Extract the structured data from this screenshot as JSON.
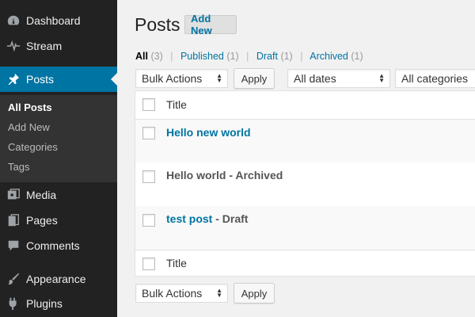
{
  "sidebar": {
    "items": [
      {
        "label": "Dashboard",
        "icon": "dashboard-icon"
      },
      {
        "label": "Stream",
        "icon": "pulse-icon"
      },
      {
        "label": "Posts",
        "icon": "pin-icon"
      },
      {
        "label": "Media",
        "icon": "media-icon"
      },
      {
        "label": "Pages",
        "icon": "pages-icon"
      },
      {
        "label": "Comments",
        "icon": "comment-icon"
      },
      {
        "label": "Appearance",
        "icon": "brush-icon"
      },
      {
        "label": "Plugins",
        "icon": "plug-icon"
      }
    ],
    "submenu": [
      "All Posts",
      "Add New",
      "Categories",
      "Tags"
    ]
  },
  "header": {
    "title": "Posts",
    "add_new": "Add New"
  },
  "filters": {
    "all": {
      "label": "All",
      "count": "(3)"
    },
    "published": {
      "label": "Published",
      "count": "(1)"
    },
    "draft": {
      "label": "Draft",
      "count": "(1)"
    },
    "archived": {
      "label": "Archived",
      "count": "(1)"
    },
    "separator": "|"
  },
  "toolbar": {
    "bulk_actions": "Bulk Actions",
    "apply": "Apply",
    "dates": "All dates",
    "categories": "All categories"
  },
  "table": {
    "column_title": "Title",
    "rows": [
      {
        "title": "Hello new world",
        "state": ""
      },
      {
        "title": "Hello world - Archived",
        "state": ""
      },
      {
        "title": "test post",
        "state": " - Draft"
      }
    ]
  },
  "colors": {
    "accent": "#0074a2",
    "sidebar_bg": "#222222",
    "submenu_bg": "#333333"
  }
}
